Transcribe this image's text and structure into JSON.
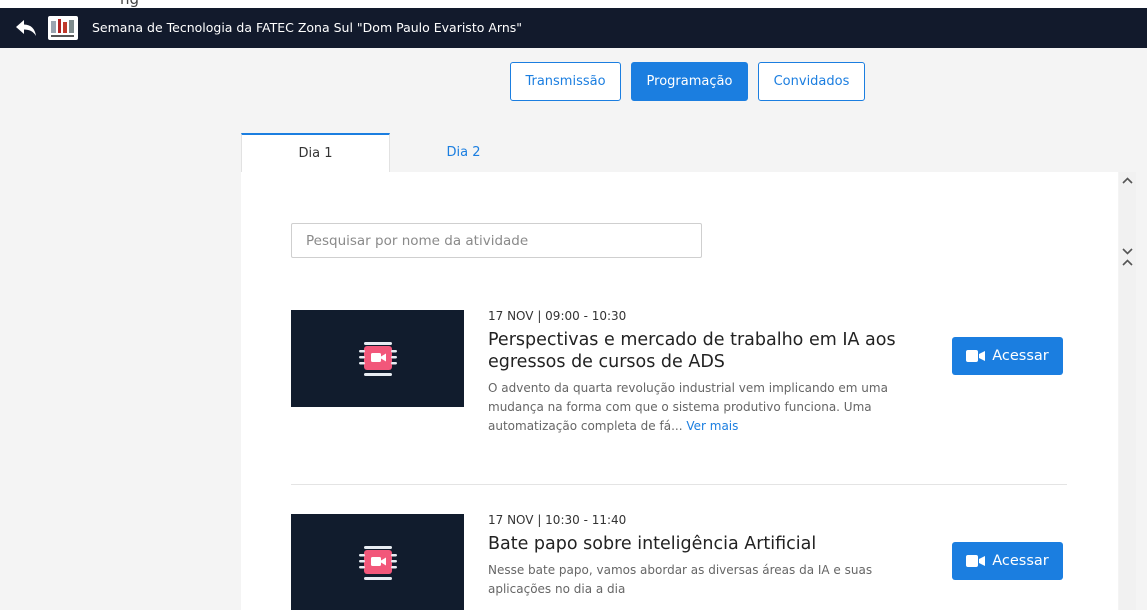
{
  "header": {
    "title": "Semana de Tecnologia da FATEC Zona Sul \"Dom Paulo Evaristo Arns\"",
    "color": "#121a2c"
  },
  "nav": {
    "transmissao": "Transmissão",
    "programacao": "Programação",
    "convidados": "Convidados",
    "active": "programacao",
    "accent": "#1b7ee0"
  },
  "tabs": [
    {
      "label": "Dia 1",
      "active": true
    },
    {
      "label": "Dia 2",
      "active": false
    }
  ],
  "search": {
    "placeholder": "Pesquisar por nome da atividade",
    "value": ""
  },
  "activities": [
    {
      "date": "17 NOV | 09:00 - 10:30",
      "title": "Perspectivas e mercado de trabalho em IA aos egressos de cursos de ADS",
      "description": "O advento da quarta revolução industrial vem implicando em uma mudança na forma com que o sistema produtivo funciona. Uma automatização completa de fá...",
      "more": "Ver mais",
      "button": "Acessar",
      "icon": "video-icon"
    },
    {
      "date": "17 NOV | 10:30 - 11:40",
      "title": "Bate papo sobre inteligência Artificial",
      "description": "Nesse bate papo, vamos abordar as diversas áreas da IA e suas aplicações no dia a dia",
      "button": "Acessar",
      "icon": "video-icon"
    }
  ]
}
